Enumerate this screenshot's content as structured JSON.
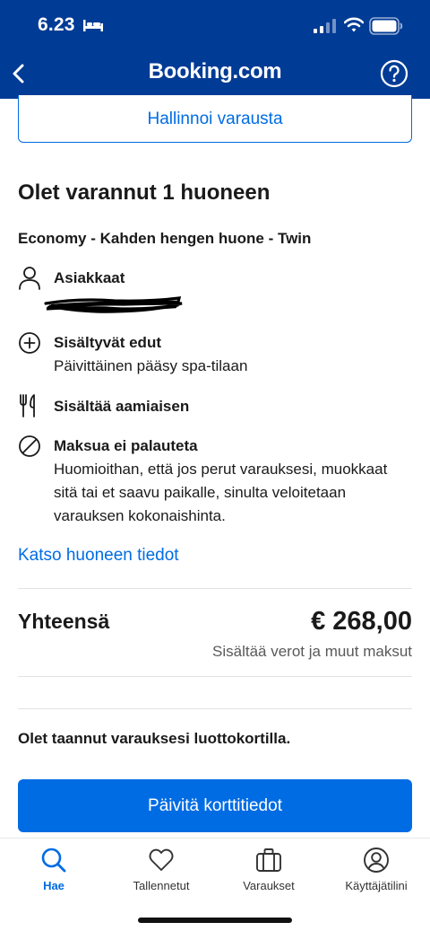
{
  "status_bar": {
    "time": "6.23"
  },
  "nav": {
    "title": "Booking.com"
  },
  "manage_button": "Hallinnoi varausta",
  "booking": {
    "title": "Olet varannut 1 huoneen",
    "room_name": "Economy - Kahden hengen huone - Twin",
    "guests_title": "Asiakkaat",
    "benefits_title": "Sisältyvät edut",
    "benefits_text": "Päivittäinen pääsy spa-tilaan",
    "breakfast_title": "Sisältää aamiaisen",
    "refund_title": "Maksua ei palauteta",
    "refund_text": "Huomioithan, että jos perut varauksesi, muokkaat sitä tai et saavu paikalle, sinulta veloitetaan varauksen kokonaishinta.",
    "room_details_link": "Katso huoneen tiedot"
  },
  "total": {
    "label": "Yhteensä",
    "amount": "€ 268,00",
    "note": "Sisältää verot ja muut maksut"
  },
  "payment": {
    "guarantee_text": "Olet taannut varauksesi luottokortilla.",
    "update_button": "Päivitä korttitiedot"
  },
  "tabs": [
    {
      "label": "Hae",
      "icon": "search-icon",
      "active": true
    },
    {
      "label": "Tallennetut",
      "icon": "heart-icon",
      "active": false
    },
    {
      "label": "Varaukset",
      "icon": "suitcase-icon",
      "active": false
    },
    {
      "label": "Käyttäjätilini",
      "icon": "account-icon",
      "active": false
    }
  ],
  "colors": {
    "brand": "#003b95",
    "accent": "#006ce4"
  }
}
